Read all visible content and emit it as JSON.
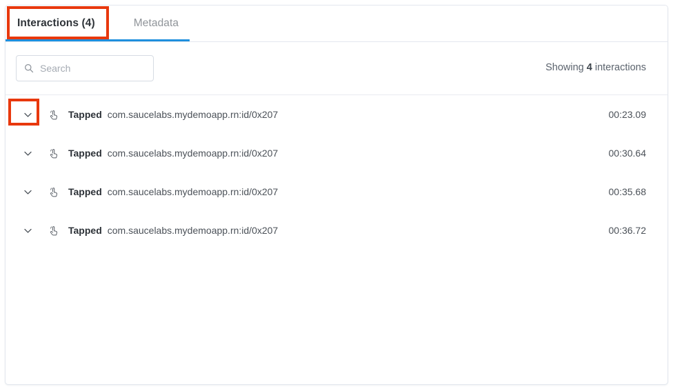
{
  "tabs": [
    {
      "label": "Interactions (4)",
      "active": true,
      "name": "tab-interactions"
    },
    {
      "label": "Metadata",
      "active": false,
      "name": "tab-metadata"
    }
  ],
  "search": {
    "value": "",
    "placeholder": "Search",
    "icon": "search-icon"
  },
  "summary": {
    "prefix": "Showing",
    "count": "4",
    "suffix": "interactions"
  },
  "interactions": [
    {
      "action": "Tapped",
      "target": "com.saucelabs.mydemoapp.rn:id/0x207",
      "time": "00:23.09",
      "icon": "tap-gesture-icon",
      "expand_icon": "chevron-down-icon"
    },
    {
      "action": "Tapped",
      "target": "com.saucelabs.mydemoapp.rn:id/0x207",
      "time": "00:30.64",
      "icon": "tap-gesture-icon",
      "expand_icon": "chevron-down-icon"
    },
    {
      "action": "Tapped",
      "target": "com.saucelabs.mydemoapp.rn:id/0x207",
      "time": "00:35.68",
      "icon": "tap-gesture-icon",
      "expand_icon": "chevron-down-icon"
    },
    {
      "action": "Tapped",
      "target": "com.saucelabs.mydemoapp.rn:id/0x207",
      "time": "00:36.72",
      "icon": "tap-gesture-icon",
      "expand_icon": "chevron-down-icon"
    }
  ],
  "colors": {
    "accent_blue": "#1f8fdd",
    "highlight_red": "#e8380d",
    "border": "#e3e7ee",
    "text_primary": "#2c3137",
    "text_secondary": "#4b5158",
    "text_muted": "#8f9499"
  }
}
